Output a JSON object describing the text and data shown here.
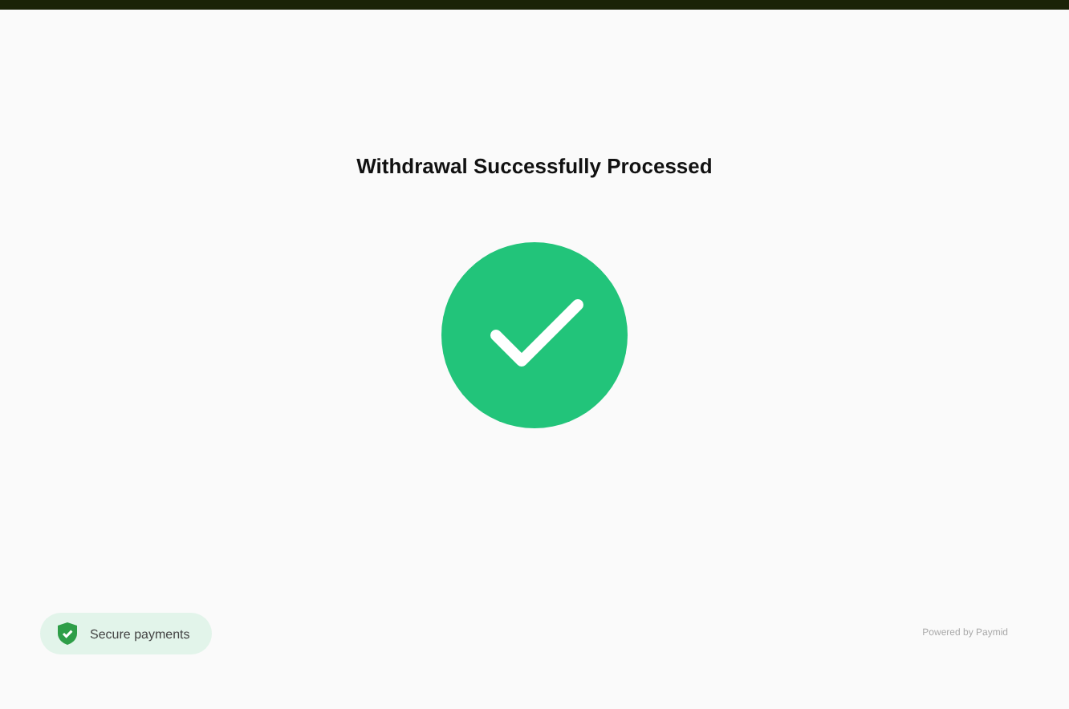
{
  "title": "Withdrawal Successfully Processed",
  "badge": {
    "label": "Secure payments"
  },
  "footer": {
    "powered_by": "Powered by Paymid"
  }
}
